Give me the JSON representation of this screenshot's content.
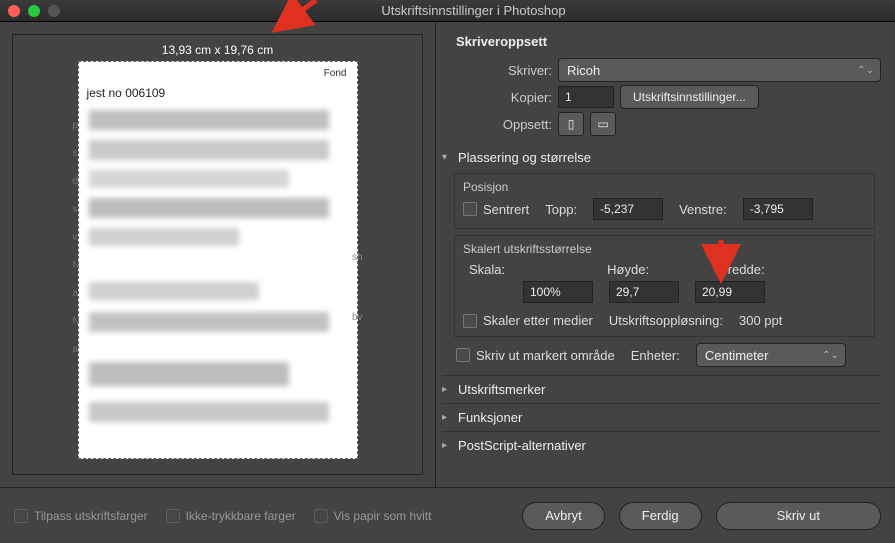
{
  "window": {
    "title": "Utskriftsinnstillinger i Photoshop"
  },
  "preview": {
    "dimensions": "13,93 cm x 19,76 cm",
    "doc_tag": "Fond",
    "doc_head": "jest no 006109"
  },
  "printer_setup": {
    "heading": "Skriveroppsett",
    "printer_label": "Skriver:",
    "printer_value": "Ricoh",
    "copies_label": "Kopier:",
    "copies_value": "1",
    "print_settings_button": "Utskriftsinnstillinger...",
    "layout_label": "Oppsett:"
  },
  "position_size": {
    "heading": "Plassering og størrelse",
    "position_label": "Posisjon",
    "center_label": "Sentrert",
    "top_label": "Topp:",
    "top_value": "-5,237",
    "left_label": "Venstre:",
    "left_value": "-3,795",
    "scaled_label": "Skalert utskriftsstørrelse",
    "scale_label": "Skala:",
    "scale_value": "100%",
    "height_label": "Høyde:",
    "height_value": "29,7",
    "width_label": "Bredde:",
    "width_value": "20,99",
    "scale_media_label": "Skaler etter medier",
    "resolution_label": "Utskriftsoppløsning:",
    "resolution_value": "300 ppt",
    "print_selected_label": "Skriv ut markert område",
    "units_label": "Enheter:",
    "units_value": "Centimeter"
  },
  "sections": {
    "marks": "Utskriftsmerker",
    "functions": "Funksjoner",
    "postscript": "PostScript-alternativer"
  },
  "bottom": {
    "match_colors": "Tilpass utskriftsfarger",
    "gamut": "Ikke-trykkbare farger",
    "paper_white": "Vis papir som hvitt",
    "cancel": "Avbryt",
    "done": "Ferdig",
    "print": "Skriv ut"
  }
}
